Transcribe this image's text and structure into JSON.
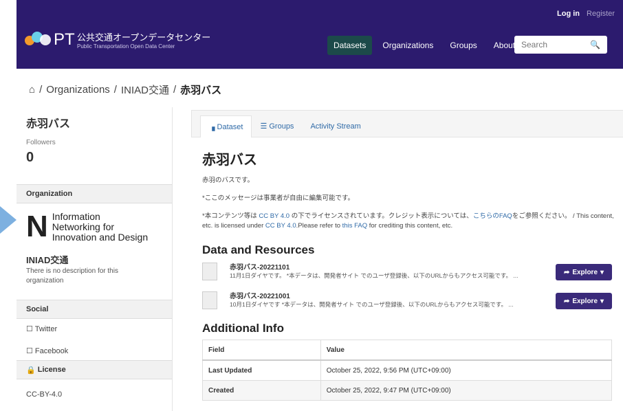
{
  "header": {
    "login": "Log in",
    "register": "Register",
    "logo_title": "公共交通オープンデータセンター",
    "logo_sub": "Public Transportation Open Data Center",
    "nav": [
      "Datasets",
      "Organizations",
      "Groups",
      "About"
    ],
    "search_placeholder": "Search"
  },
  "breadcrumb": {
    "items": [
      "Organizations",
      "INIAD交通"
    ],
    "current": "赤羽バス"
  },
  "sidebar": {
    "title": "赤羽バス",
    "followers_label": "Followers",
    "followers": "0",
    "org_heading": "Organization",
    "org_logo_lines": [
      "Information",
      "Networking for",
      "Innovation and Design"
    ],
    "org_name": "INIAD交通",
    "org_desc": "There is no description for this organization",
    "social_heading": "Social",
    "twitter": "Twitter",
    "facebook": "Facebook",
    "license_heading": "License",
    "license": "CC-BY-4.0"
  },
  "main": {
    "tabs": [
      "Dataset",
      "Groups",
      "Activity Stream"
    ],
    "title": "赤羽バス",
    "desc1": "赤羽のバスです。",
    "desc2": "*ここのメッセージは事業者が自由に編集可能です。",
    "desc3a": "*本コンテンツ等は ",
    "cc": "CC BY 4.0",
    "desc3b": " の下でライセンスされています。クレジット表示については、",
    "faq_jp": "こちらのFAQ",
    "desc3c": "をご参照ください。 / This content, etc. is licensed under ",
    "cc2": "CC BY 4.0",
    "desc3d": ".Please refer to ",
    "faq_en": "this FAQ",
    "desc3e": " for crediting this content, etc.",
    "resources_heading": "Data and Resources",
    "resources": [
      {
        "title": "赤羽バス-20221101",
        "desc": "11月1日ダイヤです。 *本データは、開発者サイト でのユーザ登録後、以下のURLからもアクセス可能です。 ..."
      },
      {
        "title": "赤羽バス-20221001",
        "desc": "10月1日ダイヤです *本データは、開発者サイト でのユーザ登録後、以下のURLからもアクセス可能です。 ..."
      }
    ],
    "explore": "Explore",
    "additional_heading": "Additional Info",
    "table_headers": [
      "Field",
      "Value"
    ],
    "rows": [
      [
        "Last Updated",
        "October 25, 2022, 9:56 PM (UTC+09:00)"
      ],
      [
        "Created",
        "October 25, 2022, 9:47 PM (UTC+09:00)"
      ]
    ]
  }
}
